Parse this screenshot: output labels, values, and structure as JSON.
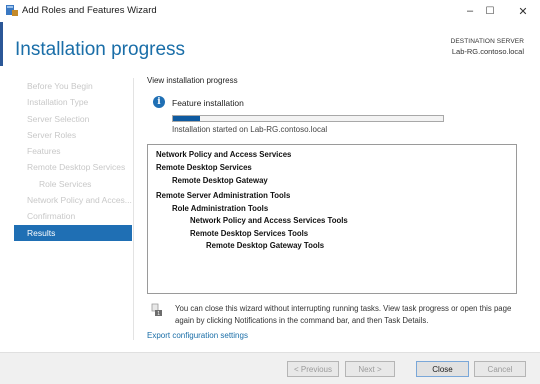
{
  "window": {
    "title": "Add Roles and Features Wizard",
    "controls": {
      "minimize": "–",
      "maximize": "☐",
      "close": "✕"
    }
  },
  "header": {
    "page_title": "Installation progress",
    "destination_label": "DESTINATION SERVER",
    "destination_server": "Lab-RG.contoso.local"
  },
  "nav": {
    "items": [
      {
        "label": "Before You Begin"
      },
      {
        "label": "Installation Type"
      },
      {
        "label": "Server Selection"
      },
      {
        "label": "Server Roles"
      },
      {
        "label": "Features"
      },
      {
        "label": "Remote Desktop Services"
      },
      {
        "label": "Role Services"
      },
      {
        "label": "Network Policy and Acces..."
      },
      {
        "label": "Confirmation"
      },
      {
        "label": "Results"
      }
    ],
    "active": "Results"
  },
  "main": {
    "subheading": "View installation progress",
    "status_title": "Feature installation",
    "progress_fraction": 0.1,
    "status_text": "Installation started on Lab-RG.contoso.local",
    "results": [
      "Network Policy and Access Services",
      "Remote Desktop Services",
      "Remote Desktop Gateway",
      "Remote Server Administration Tools",
      "Role Administration Tools",
      "Network Policy and Access Services Tools",
      "Remote Desktop Services Tools",
      "Remote Desktop Gateway Tools"
    ],
    "note": "You can close this wizard without interrupting running tasks. View task progress or open this page again by clicking Notifications in the command bar, and then Task Details.",
    "export_link": "Export configuration settings"
  },
  "footer": {
    "previous": "< Previous",
    "next": "Next >",
    "close": "Close",
    "cancel": "Cancel"
  }
}
